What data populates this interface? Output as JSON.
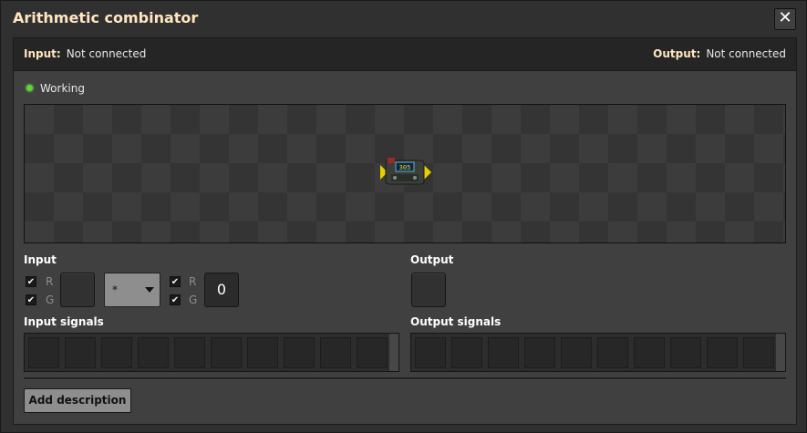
{
  "window": {
    "title": "Arithmetic combinator",
    "close_icon": "close-icon"
  },
  "connection": {
    "input_key": "Input:",
    "input_value": "Not connected",
    "output_key": "Output:",
    "output_value": "Not connected"
  },
  "status": {
    "text": "Working",
    "color": "#62d62a"
  },
  "preview": {
    "entity": "arithmetic-combinator-icon",
    "display_text": "305"
  },
  "input": {
    "label": "Input",
    "left_checkboxes": [
      {
        "label": "R",
        "checked": true
      },
      {
        "label": "G",
        "checked": true
      }
    ],
    "operator": "*",
    "right_checkboxes": [
      {
        "label": "R",
        "checked": true
      },
      {
        "label": "G",
        "checked": true
      }
    ],
    "constant": "0"
  },
  "output": {
    "label": "Output"
  },
  "signals": {
    "input_label": "Input signals",
    "output_label": "Output signals"
  },
  "add_description": "Add description"
}
